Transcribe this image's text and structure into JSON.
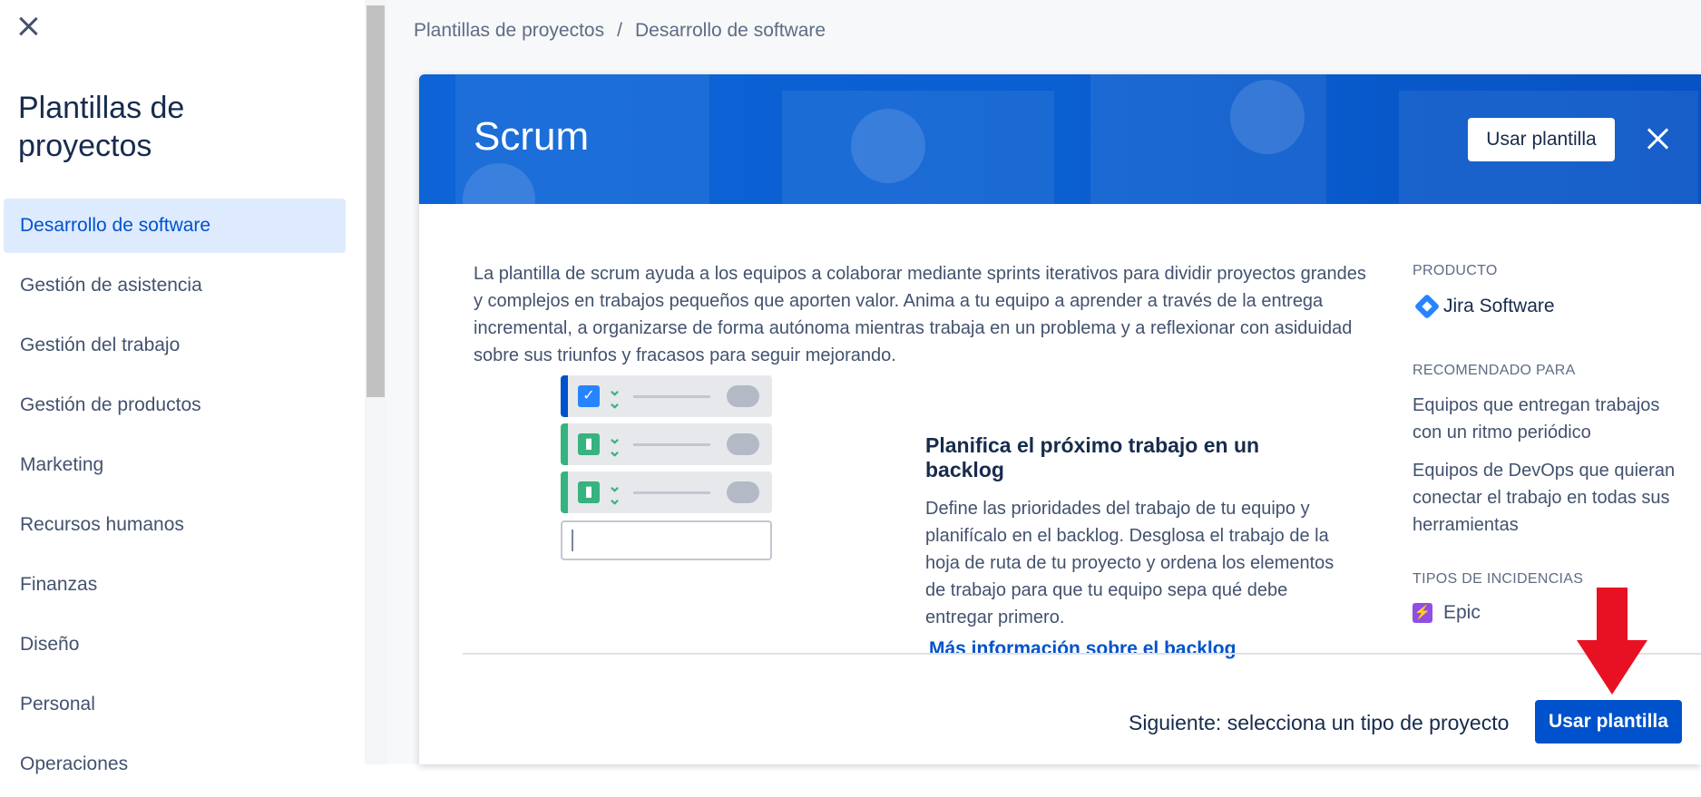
{
  "sidebar": {
    "title": "Plantillas de proyectos",
    "items": [
      {
        "label": "Desarrollo de software",
        "active": true
      },
      {
        "label": "Gestión de asistencia"
      },
      {
        "label": "Gestión del trabajo"
      },
      {
        "label": "Gestión de productos"
      },
      {
        "label": "Marketing"
      },
      {
        "label": "Recursos humanos"
      },
      {
        "label": "Finanzas"
      },
      {
        "label": "Diseño"
      },
      {
        "label": "Personal"
      },
      {
        "label": "Operaciones"
      }
    ]
  },
  "breadcrumb": {
    "root": "Plantillas de proyectos",
    "separator": "/",
    "current": "Desarrollo de software"
  },
  "modal": {
    "title": "Scrum",
    "use_template_label": "Usar plantilla",
    "description": "La plantilla de scrum ayuda a los equipos a colaborar mediante sprints iterativos para dividir proyectos grandes y complejos en trabajos pequeños que aporten valor. Anima a tu equipo a aprender a través de la entrega incremental, a organizarse de forma autónoma mientras trabaja en un problema y a reflexionar con asiduidad sobre sus triunfos y fracasos para seguir mejorando.",
    "product_heading": "PRODUCTO",
    "product_name": "Jira Software",
    "recommended_heading": "RECOMENDADO PARA",
    "recommended": [
      "Equipos que entregan trabajos con un ritmo periódico",
      "Equipos de DevOps que quieran conectar el trabajo en todas sus herramientas"
    ],
    "issue_types_heading": "TIPOS DE INCIDENCIAS",
    "issue_types": [
      "Epic"
    ],
    "feature": {
      "title": "Planifica el próximo trabajo en un backlog",
      "text": "Define las prioridades del trabajo de tu equipo y planifícalo en el backlog. Desglosa el trabajo de la hoja de ruta de tu proyecto y ordena los elementos de trabajo para que tu equipo sepa qué debe entregar primero.",
      "link": "Más información sobre el backlog"
    },
    "footer_text": "Siguiente: selecciona un tipo de proyecto",
    "footer_button": "Usar plantilla"
  },
  "colors": {
    "accent": "#0052cc",
    "banner": "#0c64d7",
    "active_nav_bg": "#deebff",
    "arrow": "#e81123",
    "epic": "#904ee2",
    "story_green": "#36b37e"
  }
}
